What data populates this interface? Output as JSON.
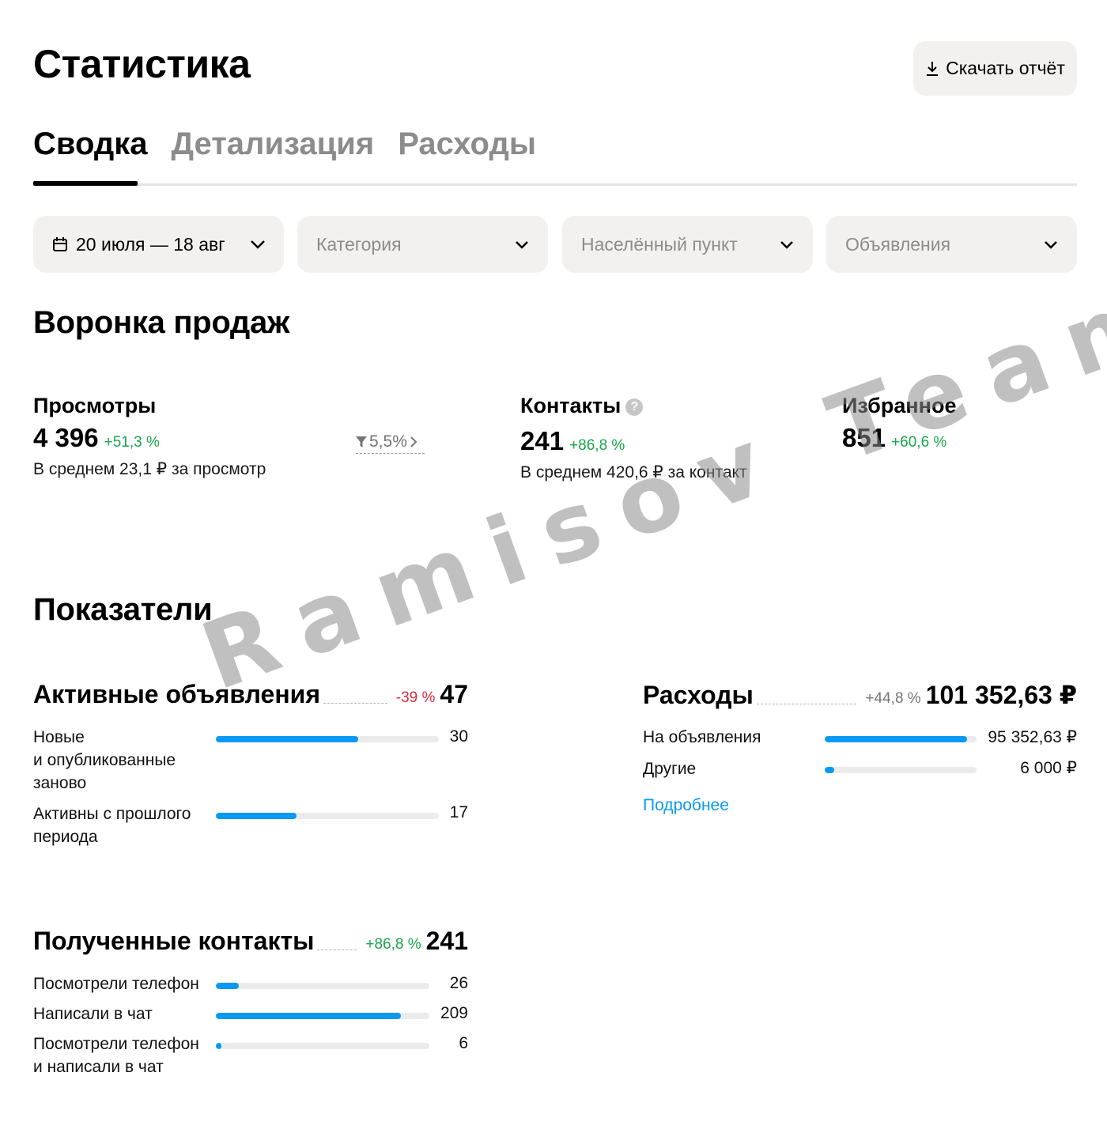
{
  "header": {
    "title": "Статистика",
    "download_label": "Скачать отчёт"
  },
  "tabs": [
    {
      "label": "Сводка",
      "active": true
    },
    {
      "label": "Детализация",
      "active": false
    },
    {
      "label": "Расходы",
      "active": false
    }
  ],
  "filters": {
    "date_range": "20 июля — 18 авг",
    "category_placeholder": "Категория",
    "locality_placeholder": "Населённый пункт",
    "listings_placeholder": "Объявления"
  },
  "funnel": {
    "title": "Воронка продаж",
    "views": {
      "title": "Просмотры",
      "value": "4 396",
      "delta": "+51,3 %",
      "sub": "В среднем 23,1 ₽ за просмотр",
      "conversion": "5,5%"
    },
    "contacts": {
      "title": "Контакты",
      "help": "?",
      "value": "241",
      "delta": "+86,8 %",
      "sub": "В среднем 420,6 ₽ за контакт"
    },
    "favorites": {
      "title": "Избранное",
      "value": "851",
      "delta": "+60,6 %"
    }
  },
  "indicators": {
    "title": "Показатели",
    "active_listings": {
      "title": "Активные объявления",
      "delta": "-39 %",
      "value": "47",
      "rows": [
        {
          "label": "Новые\nи опубликованные\nзаново",
          "value": "30",
          "fraction": 0.64
        },
        {
          "label": "Активны с прошлого\nпериода",
          "value": "17",
          "fraction": 0.36
        }
      ]
    },
    "expenses": {
      "title": "Расходы",
      "delta": "+44,8 %",
      "value": "101 352,63 ₽",
      "rows": [
        {
          "label": "На объявления",
          "value": "95 352,63 ₽",
          "fraction": 0.94
        },
        {
          "label": "Другие",
          "value": "6 000 ₽",
          "fraction": 0.06
        }
      ],
      "more_link": "Подробнее"
    },
    "contacts_received": {
      "title": "Полученные контакты",
      "delta": "+86,8 %",
      "value": "241",
      "rows": [
        {
          "label": "Посмотрели телефон",
          "value": "26",
          "fraction": 0.108
        },
        {
          "label": "Написали в чат",
          "value": "209",
          "fraction": 0.867
        },
        {
          "label": "Посмотрели телефон\nи написали в чат",
          "value": "6",
          "fraction": 0.025
        }
      ]
    }
  },
  "watermark": "Ramisov Team",
  "colors": {
    "accent_blue": "#0a99f2",
    "positive_green": "#1aa64a",
    "negative_red": "#e02a3c",
    "control_bg": "#f2f1f0"
  }
}
